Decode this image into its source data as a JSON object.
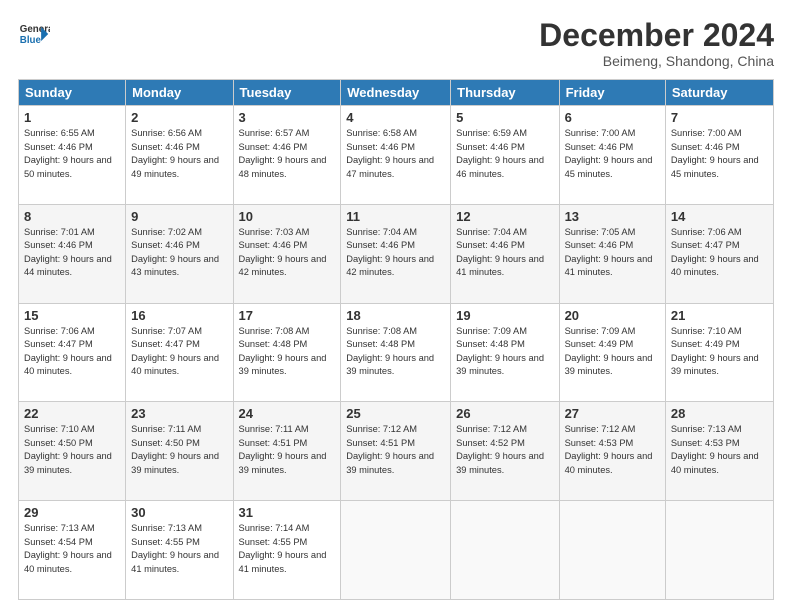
{
  "header": {
    "logo_line1": "General",
    "logo_line2": "Blue",
    "month": "December 2024",
    "location": "Beimeng, Shandong, China"
  },
  "days_of_week": [
    "Sunday",
    "Monday",
    "Tuesday",
    "Wednesday",
    "Thursday",
    "Friday",
    "Saturday"
  ],
  "weeks": [
    [
      {
        "day": "1",
        "sunrise": "6:55 AM",
        "sunset": "4:46 PM",
        "daylight": "9 hours and 50 minutes."
      },
      {
        "day": "2",
        "sunrise": "6:56 AM",
        "sunset": "4:46 PM",
        "daylight": "9 hours and 49 minutes."
      },
      {
        "day": "3",
        "sunrise": "6:57 AM",
        "sunset": "4:46 PM",
        "daylight": "9 hours and 48 minutes."
      },
      {
        "day": "4",
        "sunrise": "6:58 AM",
        "sunset": "4:46 PM",
        "daylight": "9 hours and 47 minutes."
      },
      {
        "day": "5",
        "sunrise": "6:59 AM",
        "sunset": "4:46 PM",
        "daylight": "9 hours and 46 minutes."
      },
      {
        "day": "6",
        "sunrise": "7:00 AM",
        "sunset": "4:46 PM",
        "daylight": "9 hours and 45 minutes."
      },
      {
        "day": "7",
        "sunrise": "7:00 AM",
        "sunset": "4:46 PM",
        "daylight": "9 hours and 45 minutes."
      }
    ],
    [
      {
        "day": "8",
        "sunrise": "7:01 AM",
        "sunset": "4:46 PM",
        "daylight": "9 hours and 44 minutes."
      },
      {
        "day": "9",
        "sunrise": "7:02 AM",
        "sunset": "4:46 PM",
        "daylight": "9 hours and 43 minutes."
      },
      {
        "day": "10",
        "sunrise": "7:03 AM",
        "sunset": "4:46 PM",
        "daylight": "9 hours and 42 minutes."
      },
      {
        "day": "11",
        "sunrise": "7:04 AM",
        "sunset": "4:46 PM",
        "daylight": "9 hours and 42 minutes."
      },
      {
        "day": "12",
        "sunrise": "7:04 AM",
        "sunset": "4:46 PM",
        "daylight": "9 hours and 41 minutes."
      },
      {
        "day": "13",
        "sunrise": "7:05 AM",
        "sunset": "4:46 PM",
        "daylight": "9 hours and 41 minutes."
      },
      {
        "day": "14",
        "sunrise": "7:06 AM",
        "sunset": "4:47 PM",
        "daylight": "9 hours and 40 minutes."
      }
    ],
    [
      {
        "day": "15",
        "sunrise": "7:06 AM",
        "sunset": "4:47 PM",
        "daylight": "9 hours and 40 minutes."
      },
      {
        "day": "16",
        "sunrise": "7:07 AM",
        "sunset": "4:47 PM",
        "daylight": "9 hours and 40 minutes."
      },
      {
        "day": "17",
        "sunrise": "7:08 AM",
        "sunset": "4:48 PM",
        "daylight": "9 hours and 39 minutes."
      },
      {
        "day": "18",
        "sunrise": "7:08 AM",
        "sunset": "4:48 PM",
        "daylight": "9 hours and 39 minutes."
      },
      {
        "day": "19",
        "sunrise": "7:09 AM",
        "sunset": "4:48 PM",
        "daylight": "9 hours and 39 minutes."
      },
      {
        "day": "20",
        "sunrise": "7:09 AM",
        "sunset": "4:49 PM",
        "daylight": "9 hours and 39 minutes."
      },
      {
        "day": "21",
        "sunrise": "7:10 AM",
        "sunset": "4:49 PM",
        "daylight": "9 hours and 39 minutes."
      }
    ],
    [
      {
        "day": "22",
        "sunrise": "7:10 AM",
        "sunset": "4:50 PM",
        "daylight": "9 hours and 39 minutes."
      },
      {
        "day": "23",
        "sunrise": "7:11 AM",
        "sunset": "4:50 PM",
        "daylight": "9 hours and 39 minutes."
      },
      {
        "day": "24",
        "sunrise": "7:11 AM",
        "sunset": "4:51 PM",
        "daylight": "9 hours and 39 minutes."
      },
      {
        "day": "25",
        "sunrise": "7:12 AM",
        "sunset": "4:51 PM",
        "daylight": "9 hours and 39 minutes."
      },
      {
        "day": "26",
        "sunrise": "7:12 AM",
        "sunset": "4:52 PM",
        "daylight": "9 hours and 39 minutes."
      },
      {
        "day": "27",
        "sunrise": "7:12 AM",
        "sunset": "4:53 PM",
        "daylight": "9 hours and 40 minutes."
      },
      {
        "day": "28",
        "sunrise": "7:13 AM",
        "sunset": "4:53 PM",
        "daylight": "9 hours and 40 minutes."
      }
    ],
    [
      {
        "day": "29",
        "sunrise": "7:13 AM",
        "sunset": "4:54 PM",
        "daylight": "9 hours and 40 minutes."
      },
      {
        "day": "30",
        "sunrise": "7:13 AM",
        "sunset": "4:55 PM",
        "daylight": "9 hours and 41 minutes."
      },
      {
        "day": "31",
        "sunrise": "7:14 AM",
        "sunset": "4:55 PM",
        "daylight": "9 hours and 41 minutes."
      },
      null,
      null,
      null,
      null
    ]
  ]
}
